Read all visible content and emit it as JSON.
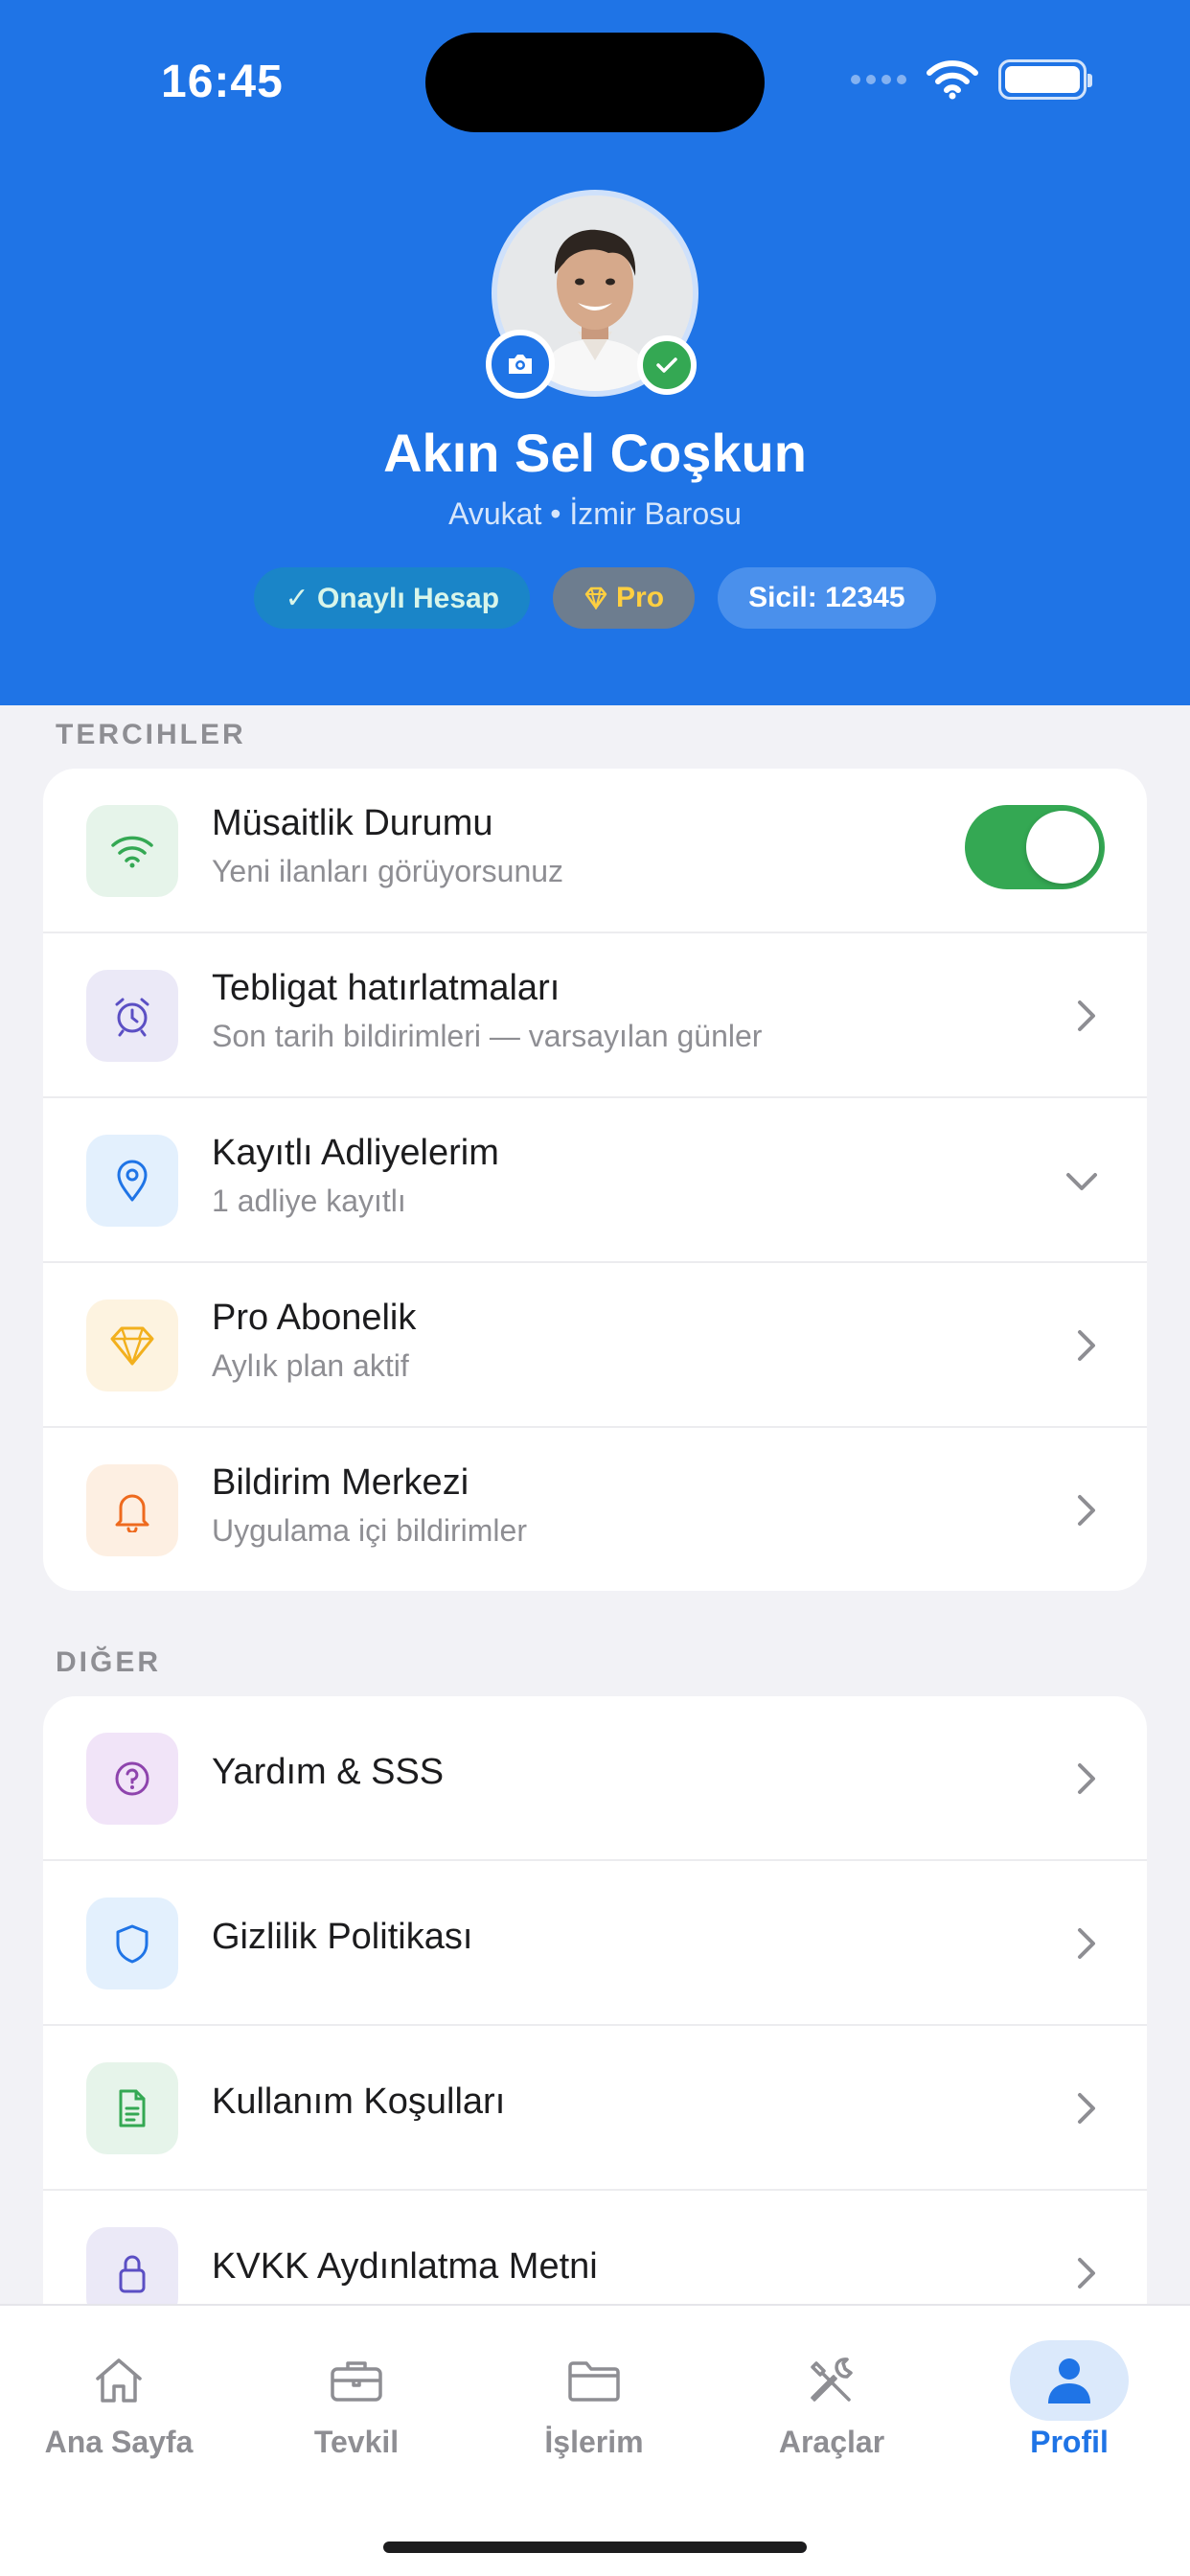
{
  "status_bar": {
    "time": "16:45"
  },
  "profile": {
    "name": "Akın Sel Coşkun",
    "subtitle": "Avukat • İzmir Barosu",
    "badges": {
      "verified": "✓ Onaylı Hesap",
      "pro": "Pro",
      "sicil": "Sicil: 12345"
    }
  },
  "preferences": {
    "title": "TERCIHLER",
    "items": [
      {
        "title": "Müsaitlik Durumu",
        "subtitle": "Yeni ilanları görüyorsunuz",
        "icon": "wifi-icon",
        "toggle_on": true
      },
      {
        "title": "Tebligat hatırlatmaları",
        "subtitle": "Son tarih bildirimleri — varsayılan günler",
        "icon": "alarm-clock-icon"
      },
      {
        "title": "Kayıtlı Adliyelerim",
        "subtitle": "1 adliye kayıtlı",
        "icon": "location-pin-icon"
      },
      {
        "title": "Pro Abonelik",
        "subtitle": "Aylık plan aktif",
        "icon": "diamond-icon"
      },
      {
        "title": "Bildirim Merkezi",
        "subtitle": "Uygulama içi bildirimler",
        "icon": "bell-icon"
      }
    ]
  },
  "other": {
    "title": "DIĞER",
    "items": [
      {
        "title": "Yardım & SSS",
        "icon": "help-icon"
      },
      {
        "title": "Gizlilik Politikası",
        "icon": "shield-icon"
      },
      {
        "title": "Kullanım Koşulları",
        "icon": "document-icon"
      },
      {
        "title": "KVKK Aydınlatma Metni",
        "icon": "lock-icon"
      }
    ]
  },
  "tabbar": {
    "tabs": [
      {
        "label": "Ana Sayfa",
        "icon": "home-icon"
      },
      {
        "label": "Tevkil",
        "icon": "briefcase-icon"
      },
      {
        "label": "İşlerim",
        "icon": "folder-icon"
      },
      {
        "label": "Araçlar",
        "icon": "tools-icon"
      },
      {
        "label": "Profil",
        "icon": "person-icon",
        "active": true
      }
    ]
  },
  "colors": {
    "primary": "#1f74e6",
    "success": "#34a853",
    "background": "#f2f2f6"
  }
}
